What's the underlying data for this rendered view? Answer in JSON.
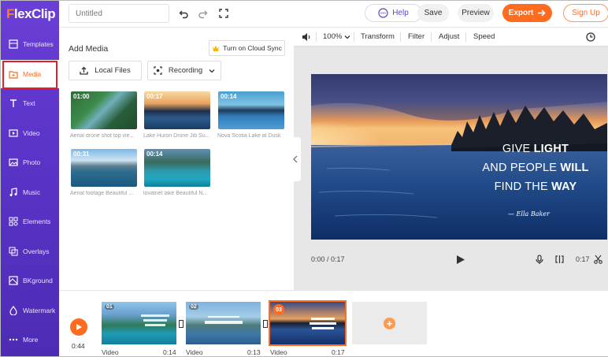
{
  "app": {
    "logo_prefix": "F",
    "logo_rest": "lexClip"
  },
  "sidebar": {
    "items": [
      {
        "label": "Templates",
        "icon": "templates-icon"
      },
      {
        "label": "Media",
        "icon": "media-icon",
        "active": true
      },
      {
        "label": "Text",
        "icon": "text-icon"
      },
      {
        "label": "Video",
        "icon": "video-icon"
      },
      {
        "label": "Photo",
        "icon": "photo-icon"
      },
      {
        "label": "Music",
        "icon": "music-icon"
      },
      {
        "label": "Elements",
        "icon": "elements-icon"
      },
      {
        "label": "Overlays",
        "icon": "overlays-icon"
      },
      {
        "label": "BKground",
        "icon": "background-icon"
      },
      {
        "label": "Watermark",
        "icon": "watermark-icon"
      },
      {
        "label": "More",
        "icon": "more-icon"
      }
    ]
  },
  "topbar": {
    "title_placeholder": "Untitled",
    "help_label": "Help",
    "save_label": "Save",
    "preview_label": "Preview",
    "export_label": "Export",
    "signup_label": "Sign Up"
  },
  "media": {
    "title": "Add Media",
    "cloud_sync_label": "Turn on Cloud Sync",
    "local_files_label": "Local Files",
    "recording_label": "Recording",
    "items": [
      {
        "duration": "01:00",
        "caption": "Aerial drone shot top vie..."
      },
      {
        "duration": "00:17",
        "caption": "Lake Huron Drone Jib Su..."
      },
      {
        "duration": "00:14",
        "caption": "Nova Scotia Lake at Dusk"
      },
      {
        "duration": "00:31",
        "caption": "Aerial footage Beautiful ..."
      },
      {
        "duration": "00:14",
        "caption": "lovatnet lake Beautiful N..."
      }
    ]
  },
  "editor": {
    "zoom": "100%",
    "tools": [
      "Transform",
      "Filter",
      "Adjust",
      "Speed"
    ],
    "quote_lines": [
      {
        "plain": "GIVE ",
        "bold": "LIGHT",
        "after": ""
      },
      {
        "plain": "AND PEOPLE ",
        "bold": "WILL",
        "after": ""
      },
      {
        "plain": "FIND THE ",
        "bold": "WAY",
        "after": ""
      }
    ],
    "signature": "— Ella Baker",
    "current_time": "0:00 / 0:17",
    "clip_time": "0:17"
  },
  "timeline": {
    "total_time": "0:44",
    "clips": [
      {
        "num": "01",
        "label": "Video",
        "duration": "0:14",
        "selected": false
      },
      {
        "num": "02",
        "label": "Video",
        "duration": "0:13",
        "selected": false
      },
      {
        "num": "03",
        "label": "Video",
        "duration": "0:17",
        "selected": true
      }
    ]
  },
  "colors": {
    "accent": "#ff6b1f",
    "sidebar": "#5b34c9",
    "highlight": "#e0202e"
  }
}
